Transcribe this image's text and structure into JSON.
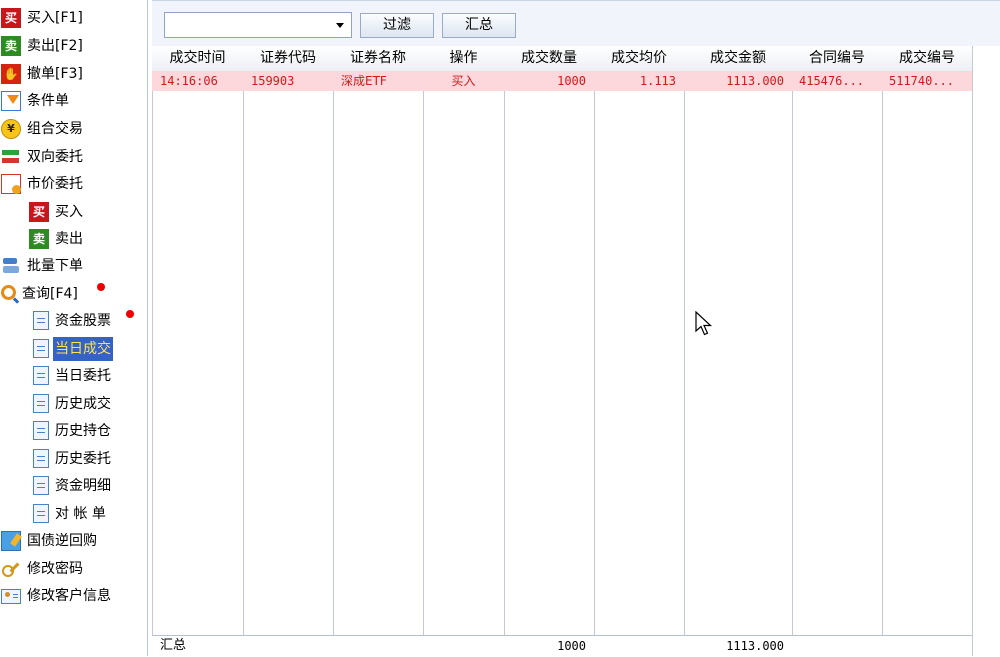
{
  "sidebar": {
    "items": [
      {
        "label": "买入[F1]",
        "icon": "buy-icon",
        "badge_char": "买"
      },
      {
        "label": "卖出[F2]",
        "icon": "sell-icon",
        "badge_char": "卖"
      },
      {
        "label": "撤单[F3]",
        "icon": "cancel-icon"
      },
      {
        "label": "条件单",
        "icon": "condition-order-icon"
      },
      {
        "label": "组合交易",
        "icon": "combo-trade-icon",
        "icon_char": "¥"
      },
      {
        "label": "双向委托",
        "icon": "two-way-order-icon"
      },
      {
        "label": "市价委托",
        "icon": "market-order-icon"
      },
      {
        "label": "买入",
        "icon": "buy-icon",
        "badge_char": "买"
      },
      {
        "label": "卖出",
        "icon": "sell-icon",
        "badge_char": "卖"
      },
      {
        "label": "批量下单",
        "icon": "batch-order-icon"
      },
      {
        "label": "查询[F4]",
        "icon": "query-icon"
      },
      {
        "label": "资金股票",
        "icon": "document-icon"
      },
      {
        "label": "当日成交",
        "icon": "document-icon",
        "selected": true
      },
      {
        "label": "当日委托",
        "icon": "document-icon"
      },
      {
        "label": "历史成交",
        "icon": "document-icon"
      },
      {
        "label": "历史持仓",
        "icon": "document-icon"
      },
      {
        "label": "历史委托",
        "icon": "document-icon"
      },
      {
        "label": "资金明细",
        "icon": "document-icon"
      },
      {
        "label": "对 帐 单",
        "icon": "document-icon"
      },
      {
        "label": "国债逆回购",
        "icon": "bond-repo-icon"
      },
      {
        "label": "修改密码",
        "icon": "key-icon"
      },
      {
        "label": "修改客户信息",
        "icon": "user-info-icon"
      }
    ]
  },
  "toolbar": {
    "filter_value": "",
    "filter_label": "过滤",
    "summary_label": "汇总"
  },
  "table": {
    "columns": [
      "成交时间",
      "证券代码",
      "证券名称",
      "操作",
      "成交数量",
      "成交均价",
      "成交金额",
      "合同编号",
      "成交编号"
    ],
    "rows": [
      [
        "14:16:06",
        "159903",
        "深成ETF",
        "买入",
        "1000",
        "1.113",
        "1113.000",
        "415476...",
        "511740..."
      ]
    ],
    "total": {
      "label": "汇总",
      "quantity": "1000",
      "amount": "1113.000"
    }
  },
  "colors": {
    "selected_bg": "#3563c4",
    "selected_text": "#ffe34d",
    "row_highlight": "#fcd7dc",
    "row_text": "#d11b1b",
    "notification_dot": "#ee0000"
  }
}
